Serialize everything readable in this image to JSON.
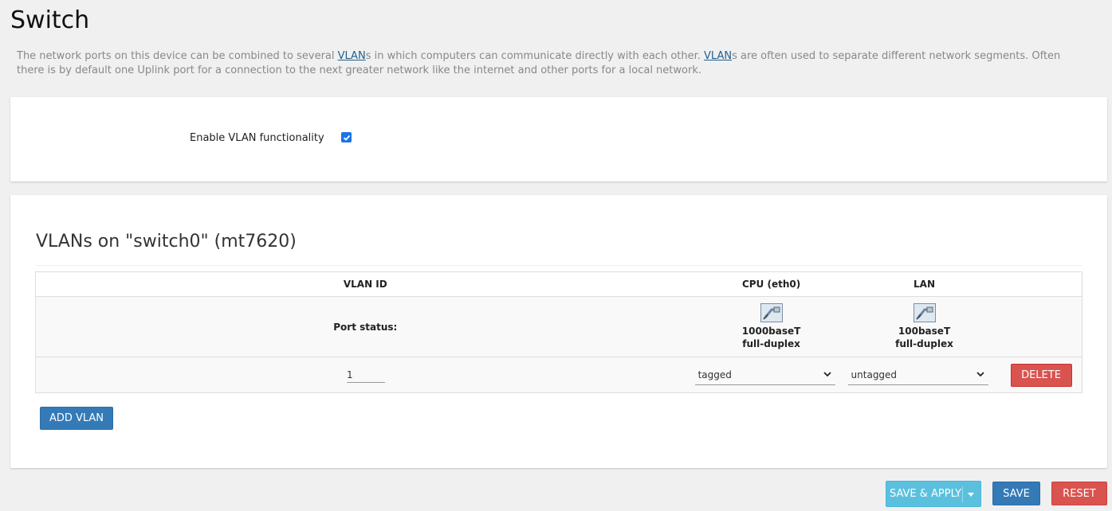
{
  "page": {
    "title": "Switch",
    "desc_1": "The network ports on this device can be combined to several ",
    "desc_link_1": "VLAN",
    "desc_2": "s in which computers can communicate directly with each other. ",
    "desc_link_2": "VLAN",
    "desc_3": "s are often used to separate different network segments. Often there is by default one Uplink port for a connection to the next greater network like the internet and other ports for a local network."
  },
  "options": {
    "enable_vlan_label": "Enable VLAN functionality",
    "enable_vlan_checked": true
  },
  "vlans": {
    "section_title": "VLANs on \"switch0\" (mt7620)",
    "columns": {
      "vlan_id": "VLAN ID",
      "cpu": "CPU (eth0)",
      "lan": "LAN"
    },
    "port_status_label": "Port status:",
    "ports": [
      {
        "speed": "1000baseT",
        "duplex": "full-duplex"
      },
      {
        "speed": "100baseT",
        "duplex": "full-duplex"
      }
    ],
    "rows": [
      {
        "vlan_id": "1",
        "cpu": "tagged",
        "lan": "untagged",
        "delete_label": "DELETE"
      }
    ],
    "add_label": "ADD VLAN"
  },
  "footer": {
    "save_apply_label": "SAVE & APPLY",
    "save_label": "SAVE",
    "reset_label": "RESET"
  },
  "colors": {
    "primary": "#337ab7",
    "danger": "#d9534f",
    "info": "#5bc0de",
    "link": "#1f5f8f"
  }
}
